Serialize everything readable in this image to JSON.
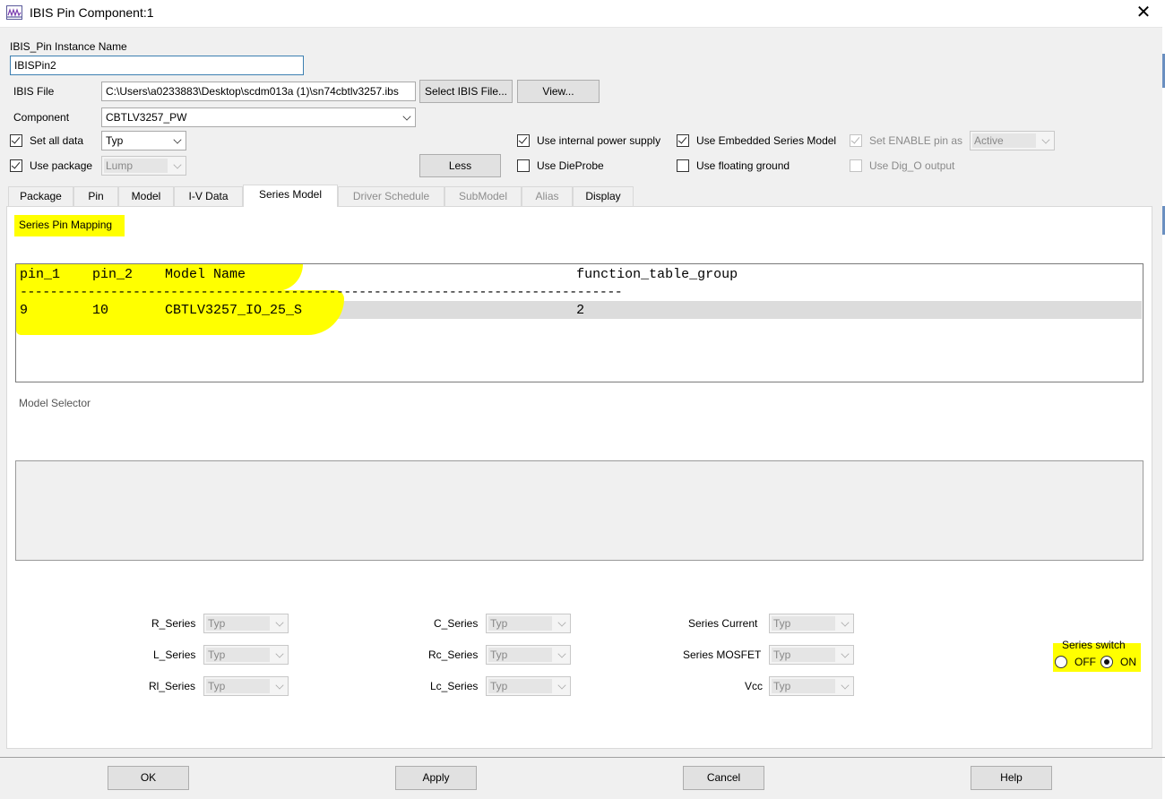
{
  "window": {
    "title": "IBIS Pin Component:1"
  },
  "instance": {
    "label": "IBIS_Pin Instance Name",
    "value": "IBISPin2"
  },
  "ibis_file": {
    "label": "IBIS File",
    "value": "C:\\Users\\a0233883\\Desktop\\scdm013a (1)\\sn74cbtlv3257.ibs",
    "select_button": "Select IBIS File...",
    "view_button": "View..."
  },
  "component": {
    "label": "Component",
    "value": "CBTLV3257_PW"
  },
  "options": {
    "set_all_data": {
      "label": "Set all data",
      "checked": true,
      "value": "Typ"
    },
    "use_package": {
      "label": "Use package",
      "checked": true,
      "value": "Lump"
    },
    "less_button": "Less",
    "use_internal_power_supply": {
      "label": "Use internal power supply",
      "checked": true
    },
    "use_dieprobe": {
      "label": "Use DieProbe",
      "checked": false
    },
    "use_embedded_series_model": {
      "label": "Use Embedded Series Model",
      "checked": true
    },
    "use_floating_ground": {
      "label": "Use floating ground",
      "checked": false
    },
    "set_enable_pin": {
      "label": "Set ENABLE pin as",
      "checked": true,
      "value": "Active"
    },
    "use_dig_o_output": {
      "label": "Use Dig_O output",
      "checked": false
    }
  },
  "tabs": [
    {
      "label": "Package"
    },
    {
      "label": "Pin"
    },
    {
      "label": "Model"
    },
    {
      "label": "I-V Data"
    },
    {
      "label": "Series Model"
    },
    {
      "label": "Driver Schedule"
    },
    {
      "label": "SubModel"
    },
    {
      "label": "Alias"
    },
    {
      "label": "Display"
    }
  ],
  "series_model": {
    "mapping_label": "Series Pin Mapping",
    "table": {
      "header": "pin_1    pin_2    Model Name                                         function_table_group",
      "separator": "--------------------------------------------------------------------------------",
      "rows": [
        "9        10       CBTLV3257_IO_25_S                                  2"
      ]
    },
    "model_selector_label": "Model Selector",
    "params": [
      {
        "label": "R_Series",
        "value": "Typ"
      },
      {
        "label": "L_Series",
        "value": "Typ"
      },
      {
        "label": "Rl_Series",
        "value": "Typ"
      },
      {
        "label": "C_Series",
        "value": "Typ"
      },
      {
        "label": "Rc_Series",
        "value": "Typ"
      },
      {
        "label": "Lc_Series",
        "value": "Typ"
      },
      {
        "label": "Series Current",
        "value": "Typ"
      },
      {
        "label": "Series MOSFET",
        "value": "Typ"
      },
      {
        "label": "Vcc",
        "value": "Typ"
      }
    ],
    "series_switch": {
      "label": "Series switch",
      "off": "OFF",
      "on": "ON",
      "selected": "ON"
    }
  },
  "footer": {
    "ok": "OK",
    "apply": "Apply",
    "cancel": "Cancel",
    "help": "Help"
  },
  "colors": {
    "highlight": "#ffff00",
    "focus_border": "#3c7fb1"
  }
}
